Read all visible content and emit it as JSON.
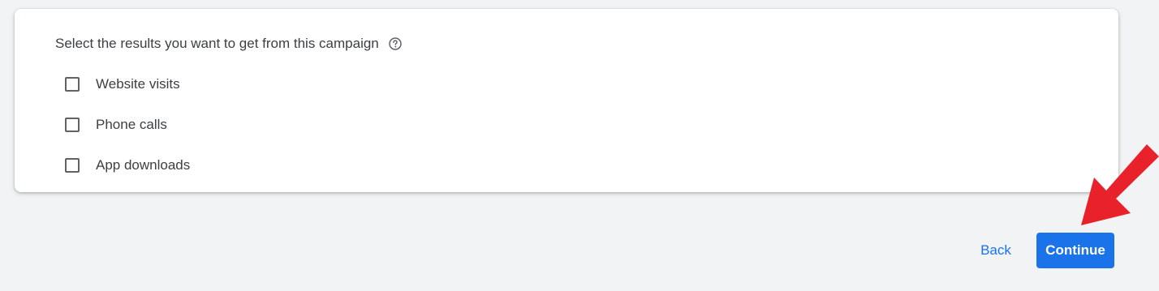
{
  "question": {
    "text": "Select the results you want to get from this campaign",
    "help_icon": "help-circle-icon"
  },
  "options": [
    {
      "label": "Website visits",
      "checked": false
    },
    {
      "label": "Phone calls",
      "checked": false
    },
    {
      "label": "App downloads",
      "checked": false
    }
  ],
  "footer": {
    "back_label": "Back",
    "continue_label": "Continue"
  },
  "colors": {
    "accent": "#1a73e8",
    "annotation_arrow": "#e8212a"
  }
}
